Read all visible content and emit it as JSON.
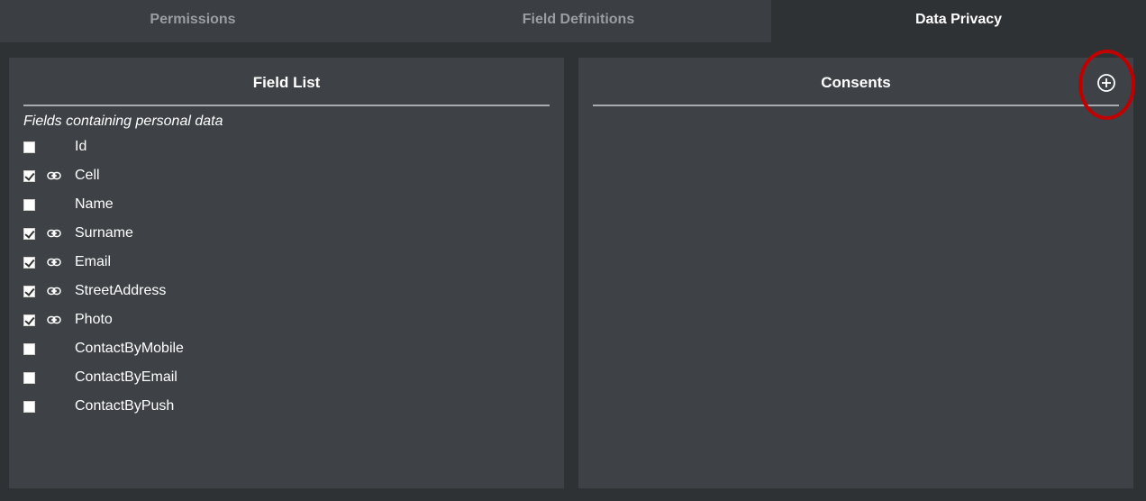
{
  "tabs": [
    {
      "label": "Permissions",
      "active": false
    },
    {
      "label": "Field Definitions",
      "active": false
    },
    {
      "label": "Data Privacy",
      "active": true
    }
  ],
  "field_list": {
    "title": "Field List",
    "subtitle": "Fields containing personal data",
    "fields": [
      {
        "label": "Id",
        "checked": false,
        "linked": false
      },
      {
        "label": "Cell",
        "checked": true,
        "linked": true
      },
      {
        "label": "Name",
        "checked": false,
        "linked": false
      },
      {
        "label": "Surname",
        "checked": true,
        "linked": true
      },
      {
        "label": "Email",
        "checked": true,
        "linked": true
      },
      {
        "label": "StreetAddress",
        "checked": true,
        "linked": true
      },
      {
        "label": "Photo",
        "checked": true,
        "linked": true
      },
      {
        "label": "ContactByMobile",
        "checked": false,
        "linked": false
      },
      {
        "label": "ContactByEmail",
        "checked": false,
        "linked": false
      },
      {
        "label": "ContactByPush",
        "checked": false,
        "linked": false
      }
    ]
  },
  "consents": {
    "title": "Consents",
    "add_icon": "plus-circle-icon"
  },
  "colors": {
    "background": "#2f3235",
    "panel": "#3e4246",
    "tab_inactive": "#3b3e42",
    "tab_inactive_text": "#9a9ea2",
    "highlight": "#c00000"
  }
}
